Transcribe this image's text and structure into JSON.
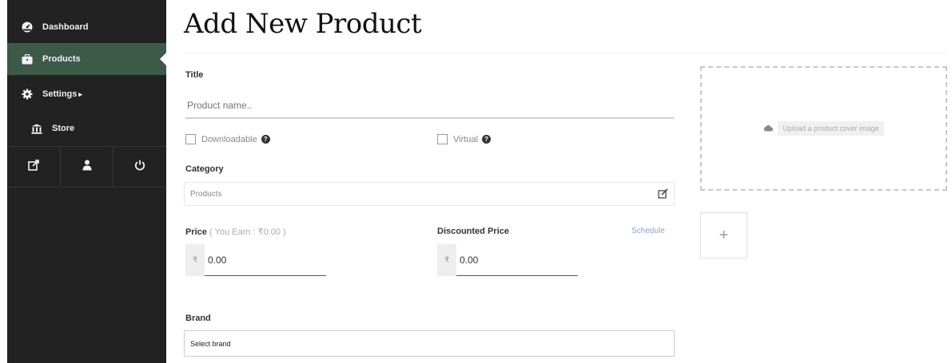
{
  "sidebar": {
    "items": [
      {
        "label": "Dashboard",
        "icon": "dashboard-icon"
      },
      {
        "label": "Products",
        "icon": "briefcase-icon",
        "active": true
      },
      {
        "label": "Settings",
        "icon": "gear-icon",
        "caret": "▸"
      },
      {
        "label": "Store",
        "icon": "bank-icon"
      }
    ],
    "bottom_icons": [
      "external-link-icon",
      "user-icon",
      "power-icon"
    ]
  },
  "page": {
    "title": "Add New Product"
  },
  "form": {
    "title_label": "Title",
    "title_placeholder": "Product name..",
    "downloadable_label": "Downloadable",
    "virtual_label": "Virtual",
    "category_label": "Category",
    "category_value": "Products",
    "price_label": "Price",
    "price_sub": "( You Earn : ₹0.00 )",
    "price_currency": "₹",
    "price_value": "0.00",
    "discounted_label": "Discounted Price",
    "discounted_currency": "₹",
    "discounted_value": "0.00",
    "schedule_link": "Schedule",
    "brand_label": "Brand",
    "brand_value": "Select brand"
  },
  "media": {
    "upload_label": "Upload a product cover image",
    "add_symbol": "+"
  },
  "colors": {
    "sidebar_bg": "#222222",
    "active_bg": "#3d5a49",
    "link": "#8a9fd6"
  }
}
